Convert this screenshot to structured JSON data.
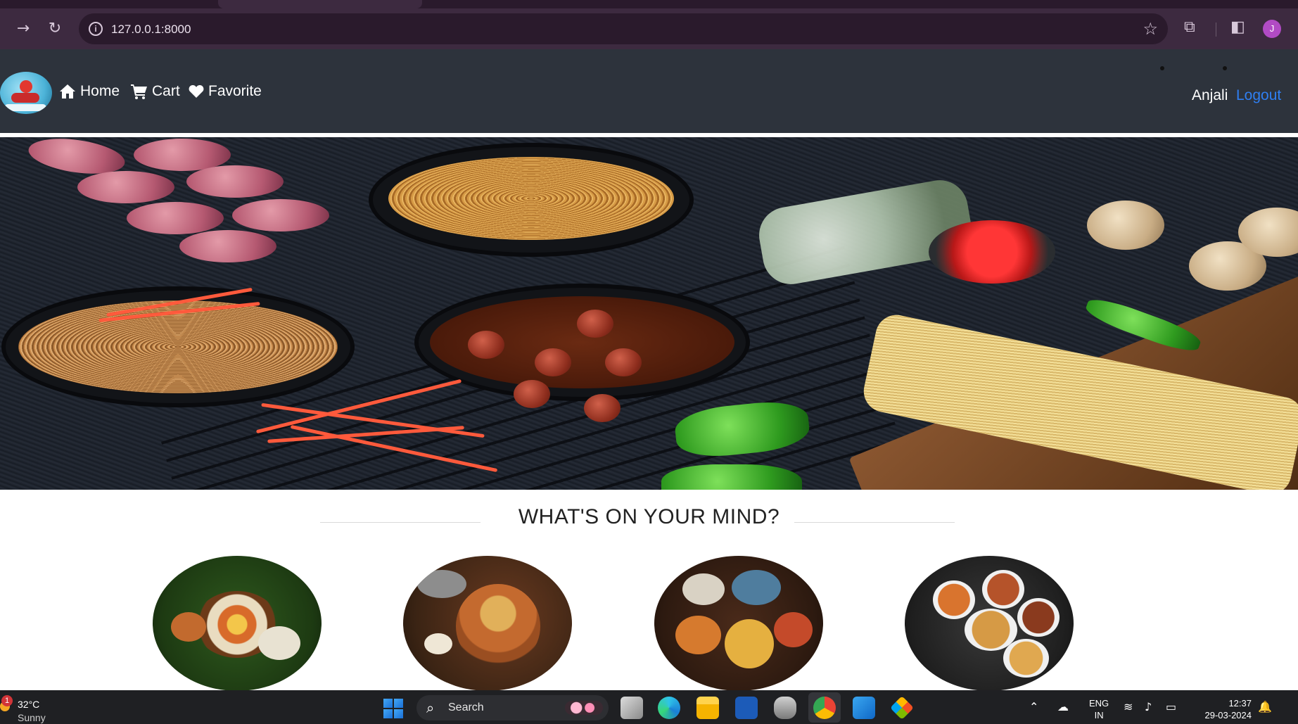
{
  "browser": {
    "url": "127.0.0.1:8000",
    "profile_initial": "J"
  },
  "navbar": {
    "links": [
      {
        "label": "Home",
        "icon": "home-icon"
      },
      {
        "label": "Cart",
        "icon": "cart-icon"
      },
      {
        "label": "Favorite",
        "icon": "heart-icon"
      }
    ],
    "user_name": "Anjali",
    "logout_label": "Logout"
  },
  "hero": {
    "image": "chinese-food-banner"
  },
  "section": {
    "title": "WHAT'S ON YOUR MIND?"
  },
  "categories": [
    {
      "image": "thali-platter"
    },
    {
      "image": "biryani-pot"
    },
    {
      "image": "mixed-dishes-platter"
    },
    {
      "image": "chinese-dishes-platter"
    }
  ],
  "taskbar": {
    "weather_badge": "1",
    "temperature": "32°C",
    "condition": "Sunny",
    "search_label": "Search",
    "language_line1": "ENG",
    "language_line2": "IN",
    "time": "12:37",
    "date": "29-03-2024"
  },
  "colors": {
    "navbar_bg": "#2d333c",
    "logout_link": "#2f7ff2",
    "browser_chrome": "#3d2a40"
  }
}
